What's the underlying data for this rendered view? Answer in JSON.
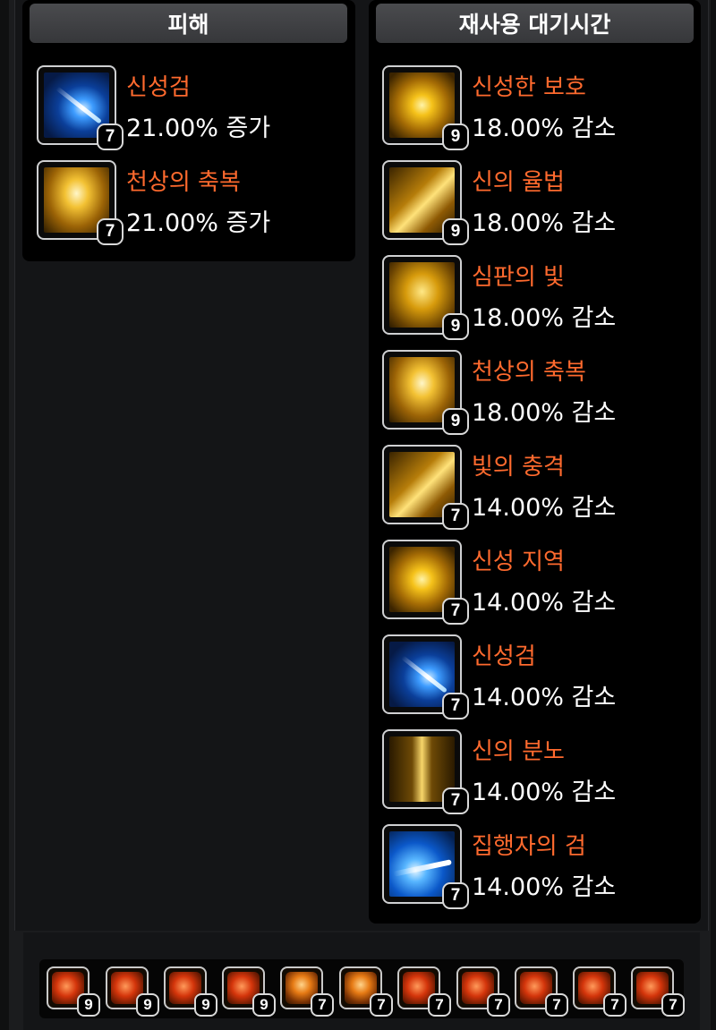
{
  "left_panel": {
    "title": "피해",
    "skills": [
      {
        "name": "신성검",
        "value": "21.00% 증가",
        "level": "7",
        "icon": "holy-sword-icon"
      },
      {
        "name": "천상의 축복",
        "value": "21.00% 증가",
        "level": "7",
        "icon": "heavenly-blessing-icon"
      }
    ]
  },
  "right_panel": {
    "title": "재사용 대기시간",
    "skills": [
      {
        "name": "신성한 보호",
        "value": "18.00% 감소",
        "level": "9",
        "icon": "holy-protection-icon"
      },
      {
        "name": "신의 율법",
        "value": "18.00% 감소",
        "level": "9",
        "icon": "divine-law-icon"
      },
      {
        "name": "심판의 빛",
        "value": "18.00% 감소",
        "level": "9",
        "icon": "light-of-judgment-icon"
      },
      {
        "name": "천상의 축복",
        "value": "18.00% 감소",
        "level": "9",
        "icon": "heavenly-blessing-icon"
      },
      {
        "name": "빛의 충격",
        "value": "14.00% 감소",
        "level": "7",
        "icon": "light-shock-icon"
      },
      {
        "name": "신성 지역",
        "value": "14.00% 감소",
        "level": "7",
        "icon": "holy-zone-icon"
      },
      {
        "name": "신성검",
        "value": "14.00% 감소",
        "level": "7",
        "icon": "holy-sword-icon"
      },
      {
        "name": "신의 분노",
        "value": "14.00% 감소",
        "level": "7",
        "icon": "divine-wrath-icon"
      },
      {
        "name": "집행자의 검",
        "value": "14.00% 감소",
        "level": "7",
        "icon": "executioner-sword-icon"
      }
    ]
  },
  "gems": [
    {
      "level": "9",
      "kind": "damage-gem-icon"
    },
    {
      "level": "9",
      "kind": "damage-gem-icon"
    },
    {
      "level": "9",
      "kind": "damage-gem-icon"
    },
    {
      "level": "9",
      "kind": "damage-gem-icon"
    },
    {
      "level": "7",
      "kind": "cooldown-gem-icon"
    },
    {
      "level": "7",
      "kind": "cooldown-gem-icon"
    },
    {
      "level": "7",
      "kind": "damage-gem-icon"
    },
    {
      "level": "7",
      "kind": "damage-gem-icon"
    },
    {
      "level": "7",
      "kind": "damage-gem-icon"
    },
    {
      "level": "7",
      "kind": "damage-gem-icon"
    },
    {
      "level": "7",
      "kind": "damage-gem-icon"
    }
  ],
  "colors": {
    "skill_name": "#ff6a2e",
    "value_text": "#ffffff",
    "panel_bg": "#000000",
    "header_bg": "#404144"
  }
}
